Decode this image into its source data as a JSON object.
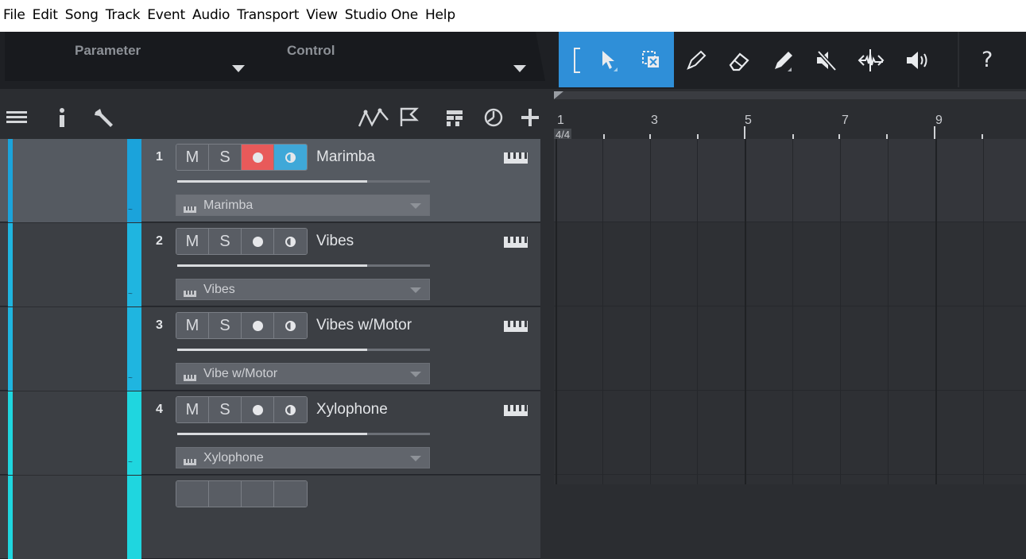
{
  "menubar": [
    "File",
    "Edit",
    "Song",
    "Track",
    "Event",
    "Audio",
    "Transport",
    "View",
    "Studio One",
    "Help"
  ],
  "topbar": {
    "parameter_label": "Parameter",
    "control_label": "Control",
    "help_label": "?"
  },
  "ruler": {
    "bars": [
      "1",
      "3",
      "5",
      "7",
      "9"
    ],
    "time_signature": "4/4"
  },
  "tracks": [
    {
      "number": "1",
      "name": "Marimba",
      "instrument": "Marimba",
      "color": "#1ba3db",
      "selected": true,
      "record_armed": true,
      "monitor_on": true,
      "volume": 0.75
    },
    {
      "number": "2",
      "name": "Vibes",
      "instrument": "Vibes",
      "color": "#1fb5e0",
      "selected": false,
      "record_armed": false,
      "monitor_on": false,
      "volume": 0.75
    },
    {
      "number": "3",
      "name": "Vibes w/Motor",
      "instrument": "Vibe w/Motor",
      "color": "#1fb5e0",
      "selected": false,
      "record_armed": false,
      "monitor_on": false,
      "volume": 0.75
    },
    {
      "number": "4",
      "name": "Xylophone",
      "instrument": "Xylophone",
      "color": "#1fd6df",
      "selected": false,
      "record_armed": false,
      "monitor_on": false,
      "volume": 0.75
    }
  ],
  "buttons": {
    "mute": "M",
    "solo": "S"
  },
  "colors": {
    "tool_active_bg": "#2f8fd8",
    "record_on": "#e85a5a",
    "monitor_on": "#3fa8d8"
  }
}
